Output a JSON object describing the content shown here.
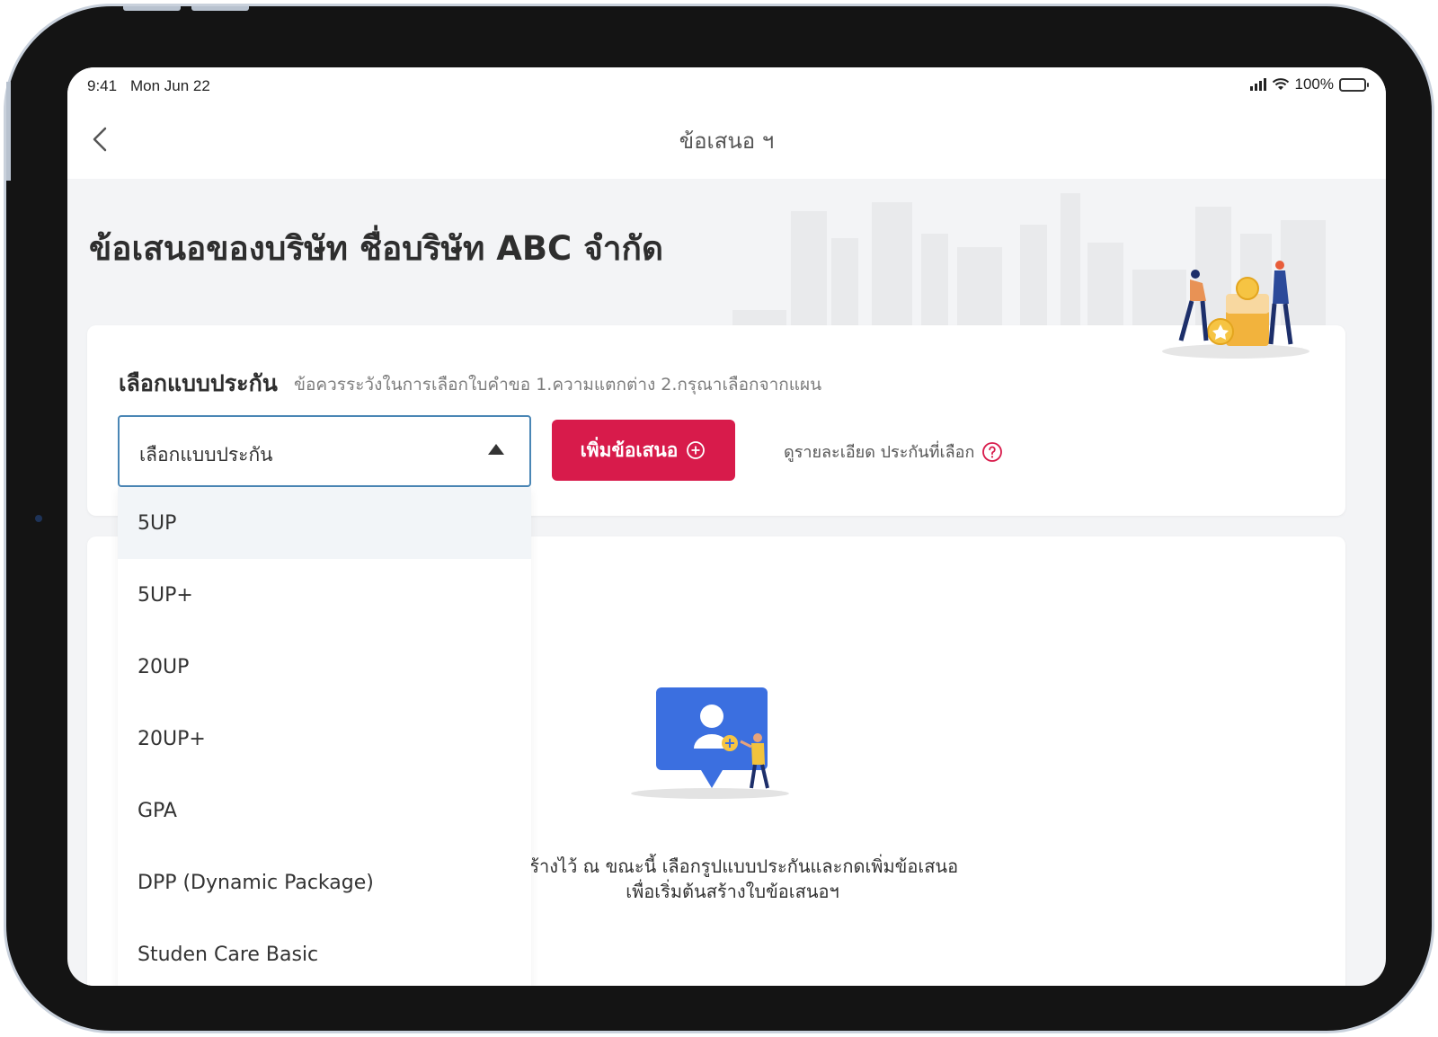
{
  "status_bar": {
    "time": "9:41",
    "date": "Mon Jun 22",
    "battery": "100%"
  },
  "nav": {
    "title": "ข้อเสนอ ฯ",
    "back_icon": "chevron-left-icon"
  },
  "header": {
    "title": "ข้อเสนอของบริษัท ชื่อบริษัท ABC จำกัด"
  },
  "plan_selector": {
    "label": "เลือกแบบประกัน",
    "hint": "ข้อควรระวังในการเลือกใบคำขอ 1.ความแตกต่าง 2.กรุณาเลือกจากแผน",
    "selected_text": "เลือกแบบประกัน",
    "options": [
      "5UP",
      "5UP+",
      "20UP",
      "20UP+",
      "GPA",
      "DPP (Dynamic Package)",
      "Studen Care Basic"
    ],
    "highlighted_index": 0,
    "expanded": true
  },
  "actions": {
    "add_offer_label": "เพิ่มข้อเสนอ",
    "add_offer_color": "#d81b4b",
    "detail_link_label": "ดูรายละเอียด ประกันที่เลือก"
  },
  "empty_state": {
    "line1": "ที่สร้างไว้ ณ ขณะนี้ เลือกรูปแบบประกันและกดเพิ่มข้อเสนอ",
    "line2": "เพื่อเริ่มต้นสร้างใบข้อเสนอฯ"
  },
  "colors": {
    "accent": "#d81b4b",
    "select_border": "#4a86b5",
    "illustration_blue": "#3b6fe0"
  }
}
